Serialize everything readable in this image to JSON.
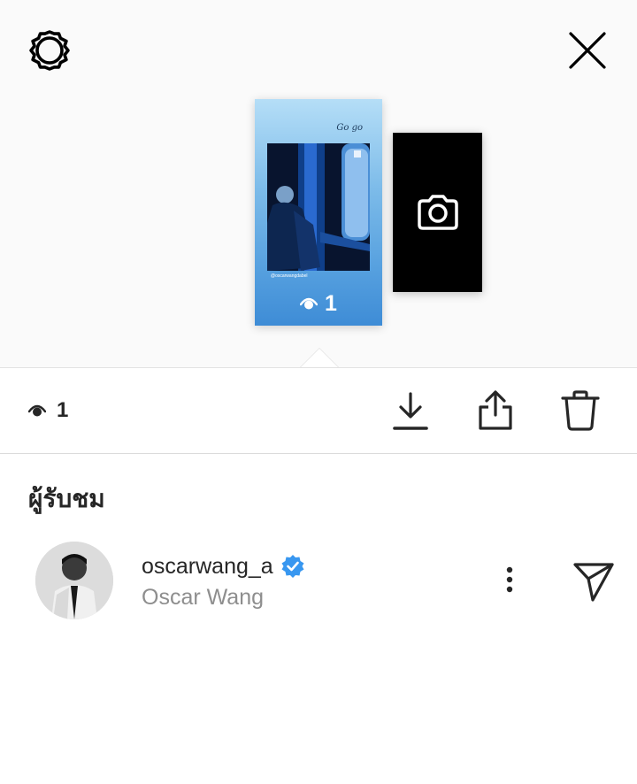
{
  "header": {
    "settings_icon": "gear-icon",
    "close_icon": "close-icon"
  },
  "story": {
    "caption": "Go go",
    "photo_handle": "@oscarwangdabel",
    "views": "1",
    "camera_icon": "camera-icon"
  },
  "actions": {
    "view_count": "1",
    "icons": [
      "download-icon",
      "share-icon",
      "trash-icon"
    ]
  },
  "viewers": {
    "title": "ผู้รับชม",
    "items": [
      {
        "username": "oscarwang_a",
        "verified": true,
        "full_name": "Oscar Wang"
      }
    ]
  },
  "colors": {
    "verified": "#3897f0",
    "secondary_text": "#8e8e8e",
    "primary_text": "#262626"
  }
}
